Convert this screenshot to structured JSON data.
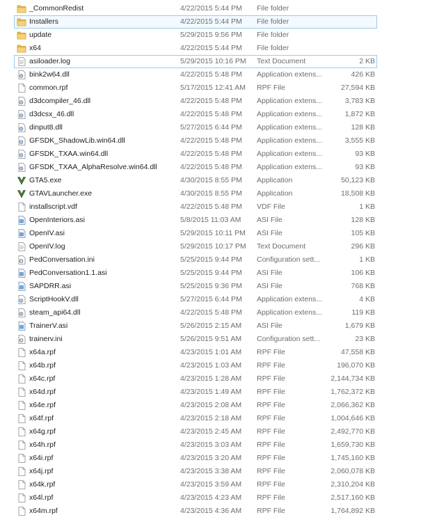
{
  "files": [
    {
      "name": "_CommonRedist",
      "date": "4/22/2015 5:44 PM",
      "type": "File folder",
      "size": "",
      "icon": "folder-icon"
    },
    {
      "name": "Installers",
      "date": "4/22/2015 5:44 PM",
      "type": "File folder",
      "size": "",
      "icon": "folder-icon",
      "state": "highlight"
    },
    {
      "name": "update",
      "date": "5/29/2015 9:56 PM",
      "type": "File folder",
      "size": "",
      "icon": "folder-icon"
    },
    {
      "name": "x64",
      "date": "4/22/2015 5:44 PM",
      "type": "File folder",
      "size": "",
      "icon": "folder-icon"
    },
    {
      "name": "asiloader.log",
      "date": "5/29/2015 10:16 PM",
      "type": "Text Document",
      "size": "2 KB",
      "icon": "text-file-icon",
      "state": "focus"
    },
    {
      "name": "bink2w64.dll",
      "date": "4/22/2015 5:48 PM",
      "type": "Application extens...",
      "size": "426 KB",
      "icon": "dll-file-icon"
    },
    {
      "name": "common.rpf",
      "date": "5/17/2015 12:41 AM",
      "type": "RPF File",
      "size": "27,594 KB",
      "icon": "blank-file-icon"
    },
    {
      "name": "d3dcompiler_46.dll",
      "date": "4/22/2015 5:48 PM",
      "type": "Application extens...",
      "size": "3,783 KB",
      "icon": "dll-file-icon"
    },
    {
      "name": "d3dcsx_46.dll",
      "date": "4/22/2015 5:48 PM",
      "type": "Application extens...",
      "size": "1,872 KB",
      "icon": "dll-file-icon"
    },
    {
      "name": "dinput8.dll",
      "date": "5/27/2015 6:44 PM",
      "type": "Application extens...",
      "size": "128 KB",
      "icon": "dll-file-icon"
    },
    {
      "name": "GFSDK_ShadowLib.win64.dll",
      "date": "4/22/2015 5:48 PM",
      "type": "Application extens...",
      "size": "3,555 KB",
      "icon": "dll-file-icon"
    },
    {
      "name": "GFSDK_TXAA.win64.dll",
      "date": "4/22/2015 5:48 PM",
      "type": "Application extens...",
      "size": "93 KB",
      "icon": "dll-file-icon"
    },
    {
      "name": "GFSDK_TXAA_AlphaResolve.win64.dll",
      "date": "4/22/2015 5:48 PM",
      "type": "Application extens...",
      "size": "93 KB",
      "icon": "dll-file-icon"
    },
    {
      "name": "GTA5.exe",
      "date": "4/30/2015 8:55 PM",
      "type": "Application",
      "size": "50,123 KB",
      "icon": "gta-v-icon"
    },
    {
      "name": "GTAVLauncher.exe",
      "date": "4/30/2015 8:55 PM",
      "type": "Application",
      "size": "18,508 KB",
      "icon": "gta-v-icon"
    },
    {
      "name": "installscript.vdf",
      "date": "4/22/2015 5:48 PM",
      "type": "VDF File",
      "size": "1 KB",
      "icon": "blank-file-icon"
    },
    {
      "name": "OpenInteriors.asi",
      "date": "5/8/2015 11:03 AM",
      "type": "ASI File",
      "size": "128 KB",
      "icon": "asi-file-icon"
    },
    {
      "name": "OpenIV.asi",
      "date": "5/29/2015 10:11 PM",
      "type": "ASI File",
      "size": "105 KB",
      "icon": "asi-file-icon"
    },
    {
      "name": "OpenIV.log",
      "date": "5/29/2015 10:17 PM",
      "type": "Text Document",
      "size": "296 KB",
      "icon": "text-file-icon"
    },
    {
      "name": "PedConversation.ini",
      "date": "5/25/2015 9:44 PM",
      "type": "Configuration sett...",
      "size": "1 KB",
      "icon": "config-file-icon"
    },
    {
      "name": "PedConversation1.1.asi",
      "date": "5/25/2015 9:44 PM",
      "type": "ASI File",
      "size": "106 KB",
      "icon": "asi-file-icon"
    },
    {
      "name": "SAPDRR.asi",
      "date": "5/25/2015 9:36 PM",
      "type": "ASI File",
      "size": "768 KB",
      "icon": "asi-file-icon"
    },
    {
      "name": "ScriptHookV.dll",
      "date": "5/27/2015 6:44 PM",
      "type": "Application extens...",
      "size": "4 KB",
      "icon": "dll-file-icon"
    },
    {
      "name": "steam_api64.dll",
      "date": "4/22/2015 5:48 PM",
      "type": "Application extens...",
      "size": "119 KB",
      "icon": "dll-file-icon"
    },
    {
      "name": "TrainerV.asi",
      "date": "5/26/2015 2:15 AM",
      "type": "ASI File",
      "size": "1,679 KB",
      "icon": "asi-file-icon"
    },
    {
      "name": "trainerv.ini",
      "date": "5/26/2015 9:51 AM",
      "type": "Configuration sett...",
      "size": "23 KB",
      "icon": "config-file-icon"
    },
    {
      "name": "x64a.rpf",
      "date": "4/23/2015 1:01 AM",
      "type": "RPF File",
      "size": "47,558 KB",
      "icon": "blank-file-icon"
    },
    {
      "name": "x64b.rpf",
      "date": "4/23/2015 1:03 AM",
      "type": "RPF File",
      "size": "196,070 KB",
      "icon": "blank-file-icon"
    },
    {
      "name": "x64c.rpf",
      "date": "4/23/2015 1:28 AM",
      "type": "RPF File",
      "size": "2,144,734 KB",
      "icon": "blank-file-icon"
    },
    {
      "name": "x64d.rpf",
      "date": "4/23/2015 1:49 AM",
      "type": "RPF File",
      "size": "1,762,372 KB",
      "icon": "blank-file-icon"
    },
    {
      "name": "x64e.rpf",
      "date": "4/23/2015 2:08 AM",
      "type": "RPF File",
      "size": "2,066,362 KB",
      "icon": "blank-file-icon"
    },
    {
      "name": "x64f.rpf",
      "date": "4/23/2015 2:18 AM",
      "type": "RPF File",
      "size": "1,004,646 KB",
      "icon": "blank-file-icon"
    },
    {
      "name": "x64g.rpf",
      "date": "4/23/2015 2:45 AM",
      "type": "RPF File",
      "size": "2,492,770 KB",
      "icon": "blank-file-icon"
    },
    {
      "name": "x64h.rpf",
      "date": "4/23/2015 3:03 AM",
      "type": "RPF File",
      "size": "1,659,730 KB",
      "icon": "blank-file-icon"
    },
    {
      "name": "x64i.rpf",
      "date": "4/23/2015 3:20 AM",
      "type": "RPF File",
      "size": "1,745,160 KB",
      "icon": "blank-file-icon"
    },
    {
      "name": "x64j.rpf",
      "date": "4/23/2015 3:38 AM",
      "type": "RPF File",
      "size": "2,060,078 KB",
      "icon": "blank-file-icon"
    },
    {
      "name": "x64k.rpf",
      "date": "4/23/2015 3:59 AM",
      "type": "RPF File",
      "size": "2,310,204 KB",
      "icon": "blank-file-icon"
    },
    {
      "name": "x64l.rpf",
      "date": "4/23/2015 4:23 AM",
      "type": "RPF File",
      "size": "2,517,160 KB",
      "icon": "blank-file-icon"
    },
    {
      "name": "x64m.rpf",
      "date": "4/23/2015 4:36 AM",
      "type": "RPF File",
      "size": "1,764,892 KB",
      "icon": "blank-file-icon"
    }
  ],
  "colors": {
    "highlight_fill": "#f3f9fe",
    "highlight_border": "#99c9ef",
    "folder": "#e8b84a",
    "gta_icon": "#4f7d3a",
    "text_primary": "#1e1e1e",
    "text_secondary": "#6d6d6d"
  }
}
